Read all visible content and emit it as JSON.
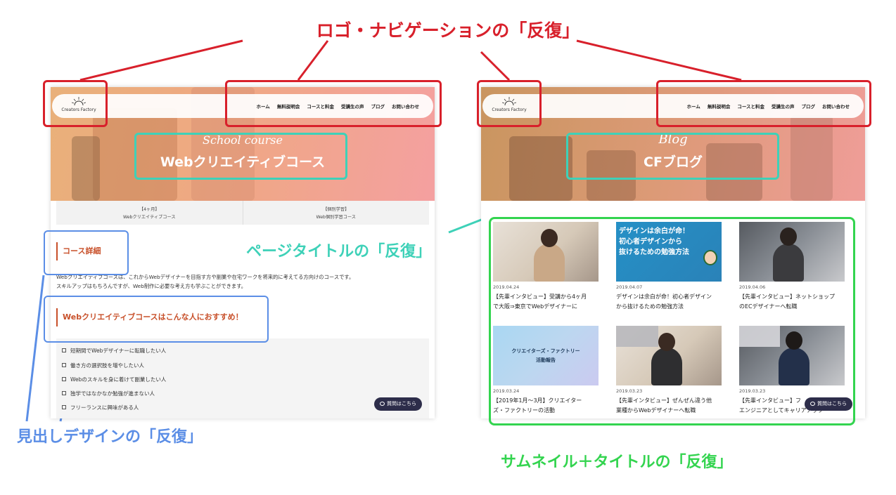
{
  "annotations": {
    "logo_nav": "ロゴ・ナビゲーションの「反復」",
    "page_title": "ページタイトルの「反復」",
    "heading_design": "見出しデザインの「反復」",
    "thumbnail_title": "サムネイル＋タイトルの「反復」",
    "colors": {
      "red": "#d8202b",
      "teal": "#3ed1b8",
      "blue": "#5b8ee6",
      "green": "#33d44f"
    }
  },
  "site": {
    "logo_text": "Creators Factory",
    "nav": [
      "ホーム",
      "無料説明会",
      "コースと料金",
      "受講生の声",
      "ブログ",
      "お問い合わせ"
    ],
    "chat_button": "質問はこちら"
  },
  "left_page": {
    "hero_script": "School course",
    "hero_title": "Webクリエイティブコース",
    "tabs": [
      {
        "line1": "【4ヶ月】",
        "line2": "Webクリエイティブコース"
      },
      {
        "line1": "【個別学習】",
        "line2": "Web個別学習コース"
      }
    ],
    "heading_course_detail": "コース詳細",
    "body_line1": "Webクリエイティブコースは、これからWebデザイナーを目指す方や副業や在宅ワークを将来的に考えてる方向けのコースです。",
    "body_line2": "スキルアップはもちろんですが、Web制作に必要な考え方も学ぶことができます。",
    "heading_recommend": "Webクリエイティブコースはこんな人におすすめ！",
    "recommend_items": [
      "短期間でWebデザイナーに転職したい人",
      "働き方の選択肢を増やしたい人",
      "Webのスキルを身に着けて副業したい人",
      "独学ではなかなか勉強が進まない人",
      "フリーランスに興味がある人"
    ]
  },
  "right_page": {
    "hero_script": "Blog",
    "hero_title": "CFブログ",
    "cards": [
      {
        "date": "2019.04.24",
        "title_line1": "【先輩インタビュー】受講から4ヶ月",
        "title_line2": "で大阪⇒東京でWebデザイナーに",
        "thumb": "photo-woman"
      },
      {
        "date": "2019.04.07",
        "title_line1": "デザインは余白が命！初心者デザイン",
        "title_line2": "から抜けるための勉強方法",
        "thumb": "banner-blue",
        "thumb_text": [
          "デザインは余白が命！",
          "初心者デザインから",
          "抜けるための勉強方法"
        ]
      },
      {
        "date": "2019.04.06",
        "title_line1": "【先輩インタビュー】ネットショップ",
        "title_line2": "のECデザイナーへ転職",
        "thumb": "photo-woman-glasses"
      },
      {
        "date": "2019.03.24",
        "title_line1": "【2019年1月〜3月】クリエイター",
        "title_line2": "ズ・ファクトリーの活動",
        "thumb": "banner-gradient",
        "thumb_text": [
          "クリエイターズ・ファクトリー",
          "活動報告"
        ]
      },
      {
        "date": "2019.03.23",
        "title_line1": "【先輩インタビュー】ぜんぜん違う他",
        "title_line2": "業種からWebデザイナーへ転職",
        "thumb": "photo-woman-laptop"
      },
      {
        "date": "2019.03.23",
        "title_line1": "【先輩インタビュー】フ",
        "title_line2": "エンジニアとしてキャリアアップ",
        "thumb": "photo-man-laptop"
      }
    ]
  }
}
